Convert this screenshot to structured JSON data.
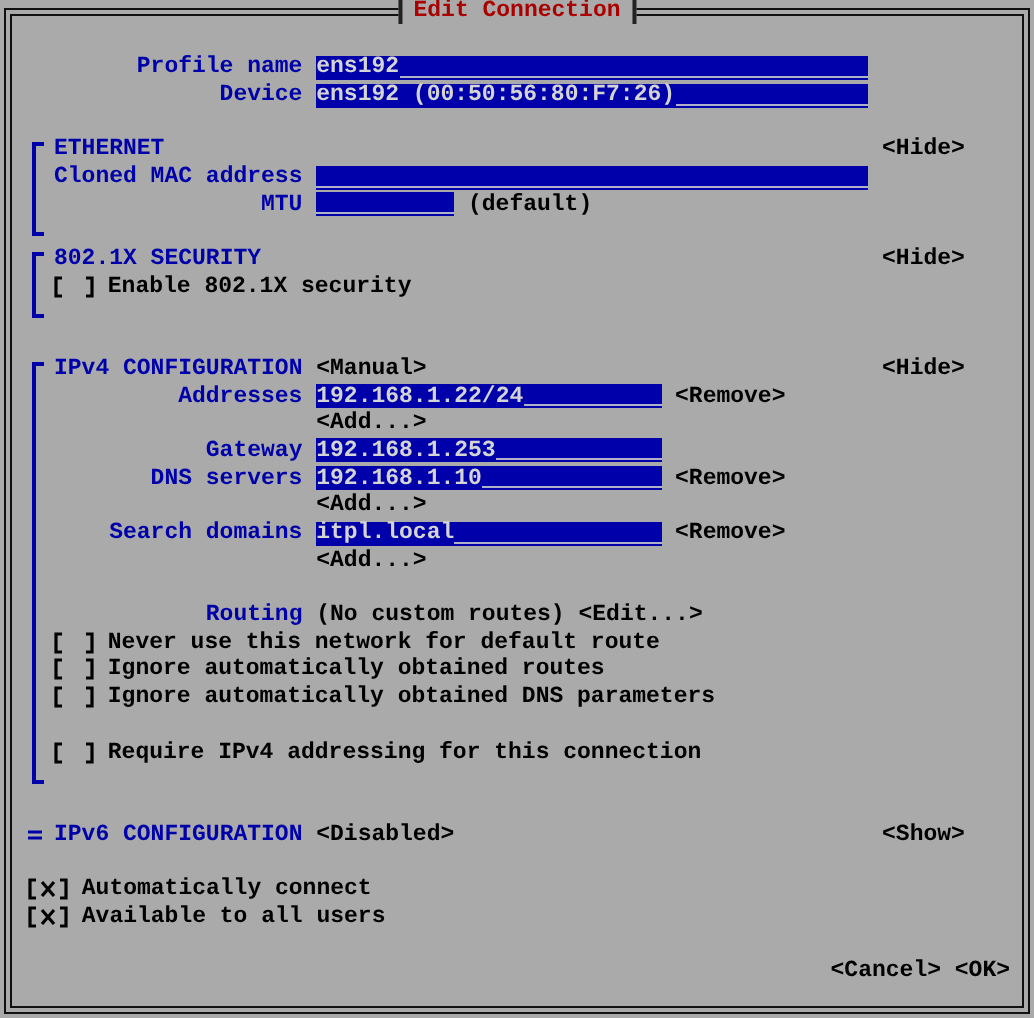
{
  "dialog": {
    "title": "Edit Connection"
  },
  "profile": [
    {
      "label": "Profile name",
      "value": "ens192"
    },
    {
      "label": "Device",
      "value": "ens192 (00:50:56:80:F7:26)"
    }
  ],
  "sections": [
    {
      "kind": "ethernet",
      "title": "ETHERNET",
      "toggle": "<Hide>",
      "expanded": true,
      "blocks": [
        [
          {
            "kind": "field",
            "label": "Cloned MAC address"
          },
          {
            "kind": "short_field",
            "label": "MTU",
            "note": "(default)"
          }
        ]
      ]
    },
    {
      "kind": "security",
      "title": "802.1X SECURITY",
      "toggle": "<Hide>",
      "expanded": true,
      "blocks": [
        [
          {
            "kind": "checkbox",
            "label": "Enable 802.1X security",
            "checked": false
          }
        ]
      ]
    },
    {
      "kind": "ipv4",
      "title": "IPv4 CONFIGURATION",
      "mode": "<Manual>",
      "toggle": "<Hide>",
      "expanded": true,
      "blocks": [
        [
          {
            "kind": "list_field",
            "label": "Addresses",
            "items": [
              {
                "value": "192.168.1.22/24",
                "remove": "<Remove>"
              }
            ],
            "add": "<Add...>"
          },
          {
            "kind": "medium_field",
            "label": "Gateway",
            "value": "192.168.1.253"
          },
          {
            "kind": "list_field",
            "label": "DNS servers",
            "items": [
              {
                "value": "192.168.1.10",
                "remove": "<Remove>"
              }
            ],
            "add": "<Add...>"
          },
          {
            "kind": "list_field",
            "label": "Search domains",
            "items": [
              {
                "value": "itpl.local",
                "remove": "<Remove>"
              }
            ],
            "add": "<Add...>"
          }
        ],
        [
          {
            "kind": "routing",
            "label": "Routing",
            "value": "(No custom routes)",
            "action": "<Edit...>"
          },
          {
            "kind": "checkbox",
            "label": "Never use this network for default route",
            "checked": false
          },
          {
            "kind": "checkbox",
            "label": "Ignore automatically obtained routes",
            "checked": false
          },
          {
            "kind": "checkbox",
            "label": "Ignore automatically obtained DNS parameters",
            "checked": false
          }
        ],
        [
          {
            "kind": "checkbox",
            "label": "Require IPv4 addressing for this connection",
            "checked": false
          }
        ]
      ]
    },
    {
      "kind": "ipv6",
      "title": "IPv6 CONFIGURATION",
      "mode": "<Disabled>",
      "toggle": "<Show>",
      "expanded": false
    }
  ],
  "options": [
    {
      "label": "Automatically connect",
      "checked": true
    },
    {
      "label": "Available to all users",
      "checked": true
    }
  ],
  "buttons": [
    "<Cancel>",
    "<OK>"
  ]
}
